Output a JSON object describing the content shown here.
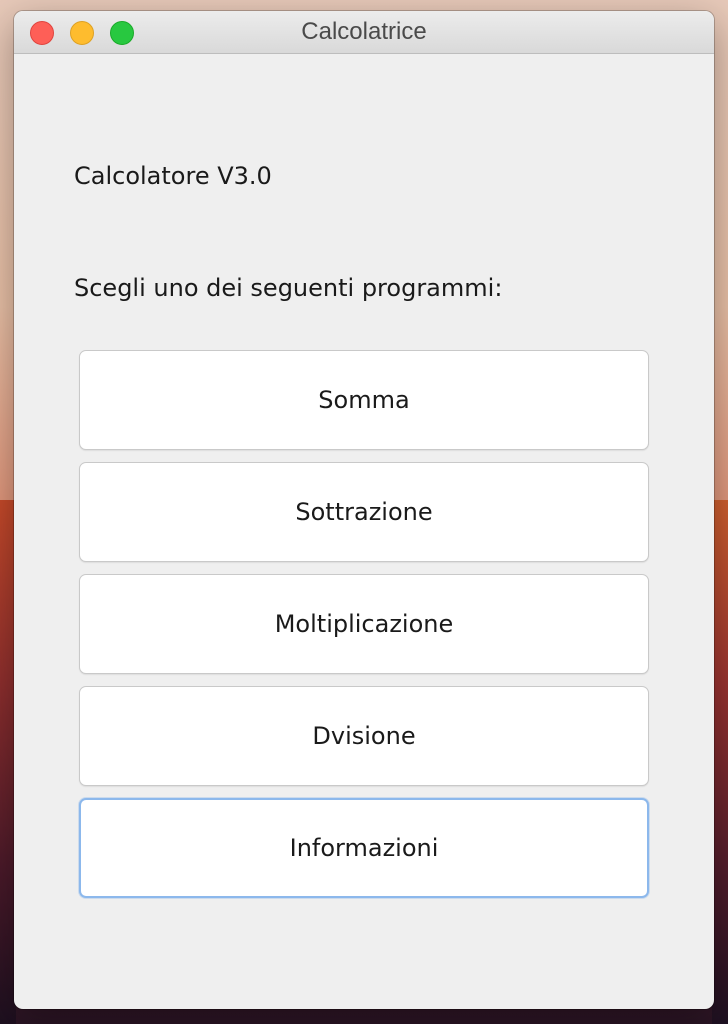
{
  "window": {
    "title": "Calcolatrice"
  },
  "content": {
    "heading": "Calcolatore V3.0",
    "prompt": "Scegli uno dei seguenti programmi:"
  },
  "buttons": [
    {
      "label": "Somma"
    },
    {
      "label": "Sottrazione"
    },
    {
      "label": "Moltiplicazione"
    },
    {
      "label": "Dvisione"
    },
    {
      "label": "Informazioni"
    }
  ],
  "colors": {
    "window_bg": "#efefef",
    "button_bg": "#ffffff",
    "focus_ring": "#8cb8ec",
    "close": "#fe5f57",
    "minimize": "#febc2e",
    "zoom": "#28c840"
  }
}
